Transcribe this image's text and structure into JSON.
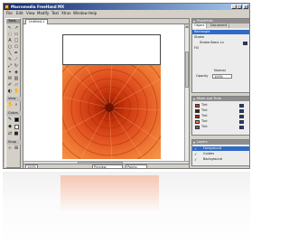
{
  "window": {
    "title": "Macromedia FreeHand MX"
  },
  "menu": [
    "File",
    "Edit",
    "View",
    "Modify",
    "Text",
    "Xtras",
    "Window",
    "Help"
  ],
  "tools_panel": {
    "title": "Tools",
    "view_label": "View",
    "colors_label": "Colors",
    "snap_label": "Snap"
  },
  "document": {
    "tab_label": "Untitled-1",
    "status_view": "Preview",
    "status_units": "Points",
    "zoom": "100%"
  },
  "properties_panel": {
    "title": "Properties",
    "tabs": [
      "Object",
      "Document"
    ],
    "items": [
      "Rectangle",
      "Stroke",
      "Fill"
    ],
    "stroke_detail": "Stroke Basic Ln",
    "blend_mode": "Normal",
    "blend_label": "Blend",
    "opacity_label": "Opacity",
    "opacity_value": "100%"
  },
  "layers_panel": {
    "title": "Layers",
    "items": [
      "Foreground",
      "Guides",
      "Background"
    ]
  },
  "swatches_panel": {
    "title": "Mixer and Tints",
    "rows": [
      "Tint",
      "Tint",
      "Tint",
      "Tint",
      "Tint"
    ]
  },
  "colors": {
    "titlebar": "#0a246a",
    "chrome": "#d4d0c8",
    "selection": "#316ac5",
    "flower": "#e0501f"
  }
}
